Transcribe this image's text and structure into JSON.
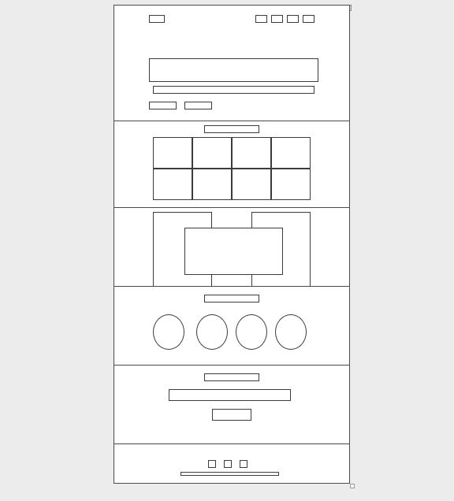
{
  "window": {
    "controls": [
      "close-icon",
      "minimize-icon",
      "maximize-icon"
    ],
    "address_bar": ""
  },
  "header": {
    "logo": "",
    "nav_items": [
      "",
      "",
      "",
      ""
    ]
  },
  "hero": {
    "headline": "",
    "subheadline": "",
    "buttons": [
      "",
      ""
    ]
  },
  "grid_section": {
    "title": "",
    "tiles": [
      "",
      "",
      "",
      "",
      "",
      "",
      "",
      ""
    ]
  },
  "feature_section": {
    "panels": [
      "",
      "",
      ""
    ]
  },
  "circles_section": {
    "title": "",
    "items": [
      "",
      "",
      "",
      ""
    ]
  },
  "cta_section": {
    "title": "",
    "input_placeholder": "",
    "button": ""
  },
  "footer": {
    "icons": [
      "",
      "",
      ""
    ],
    "text": ""
  },
  "colors": {
    "line": "#3c3c3c",
    "page_bg": "#ececec",
    "canvas": "#ffffff"
  }
}
